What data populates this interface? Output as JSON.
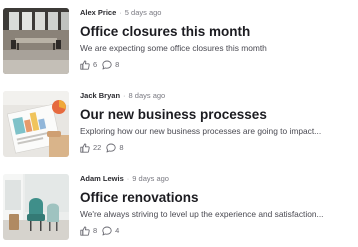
{
  "posts": [
    {
      "author": "Alex Price",
      "time": "5 days ago",
      "title": "Office closures this month",
      "excerpt": "We are expecting some office closures this momth",
      "likes": "6",
      "comments": "8",
      "image": "office-meeting-room-photo"
    },
    {
      "author": "Jack Bryan",
      "time": "8 days ago",
      "title": "Our new business processes",
      "excerpt": "Exploring how our new business processes are going to impact...",
      "likes": "22",
      "comments": "8",
      "image": "charts-documents-photo"
    },
    {
      "author": "Adam Lewis",
      "time": "9 days ago",
      "title": "Office renovations",
      "excerpt": "We're always striving to level up the experience and satisfaction...",
      "likes": "8",
      "comments": "4",
      "image": "office-lounge-chairs-photo"
    }
  ],
  "icons": {
    "separator": "·",
    "like": "thumbs-up-icon",
    "comment": "comment-bubble-icon"
  },
  "colors": {
    "title": "#1c1c21",
    "meta": "#7a7a82",
    "text": "#4a4a52"
  }
}
